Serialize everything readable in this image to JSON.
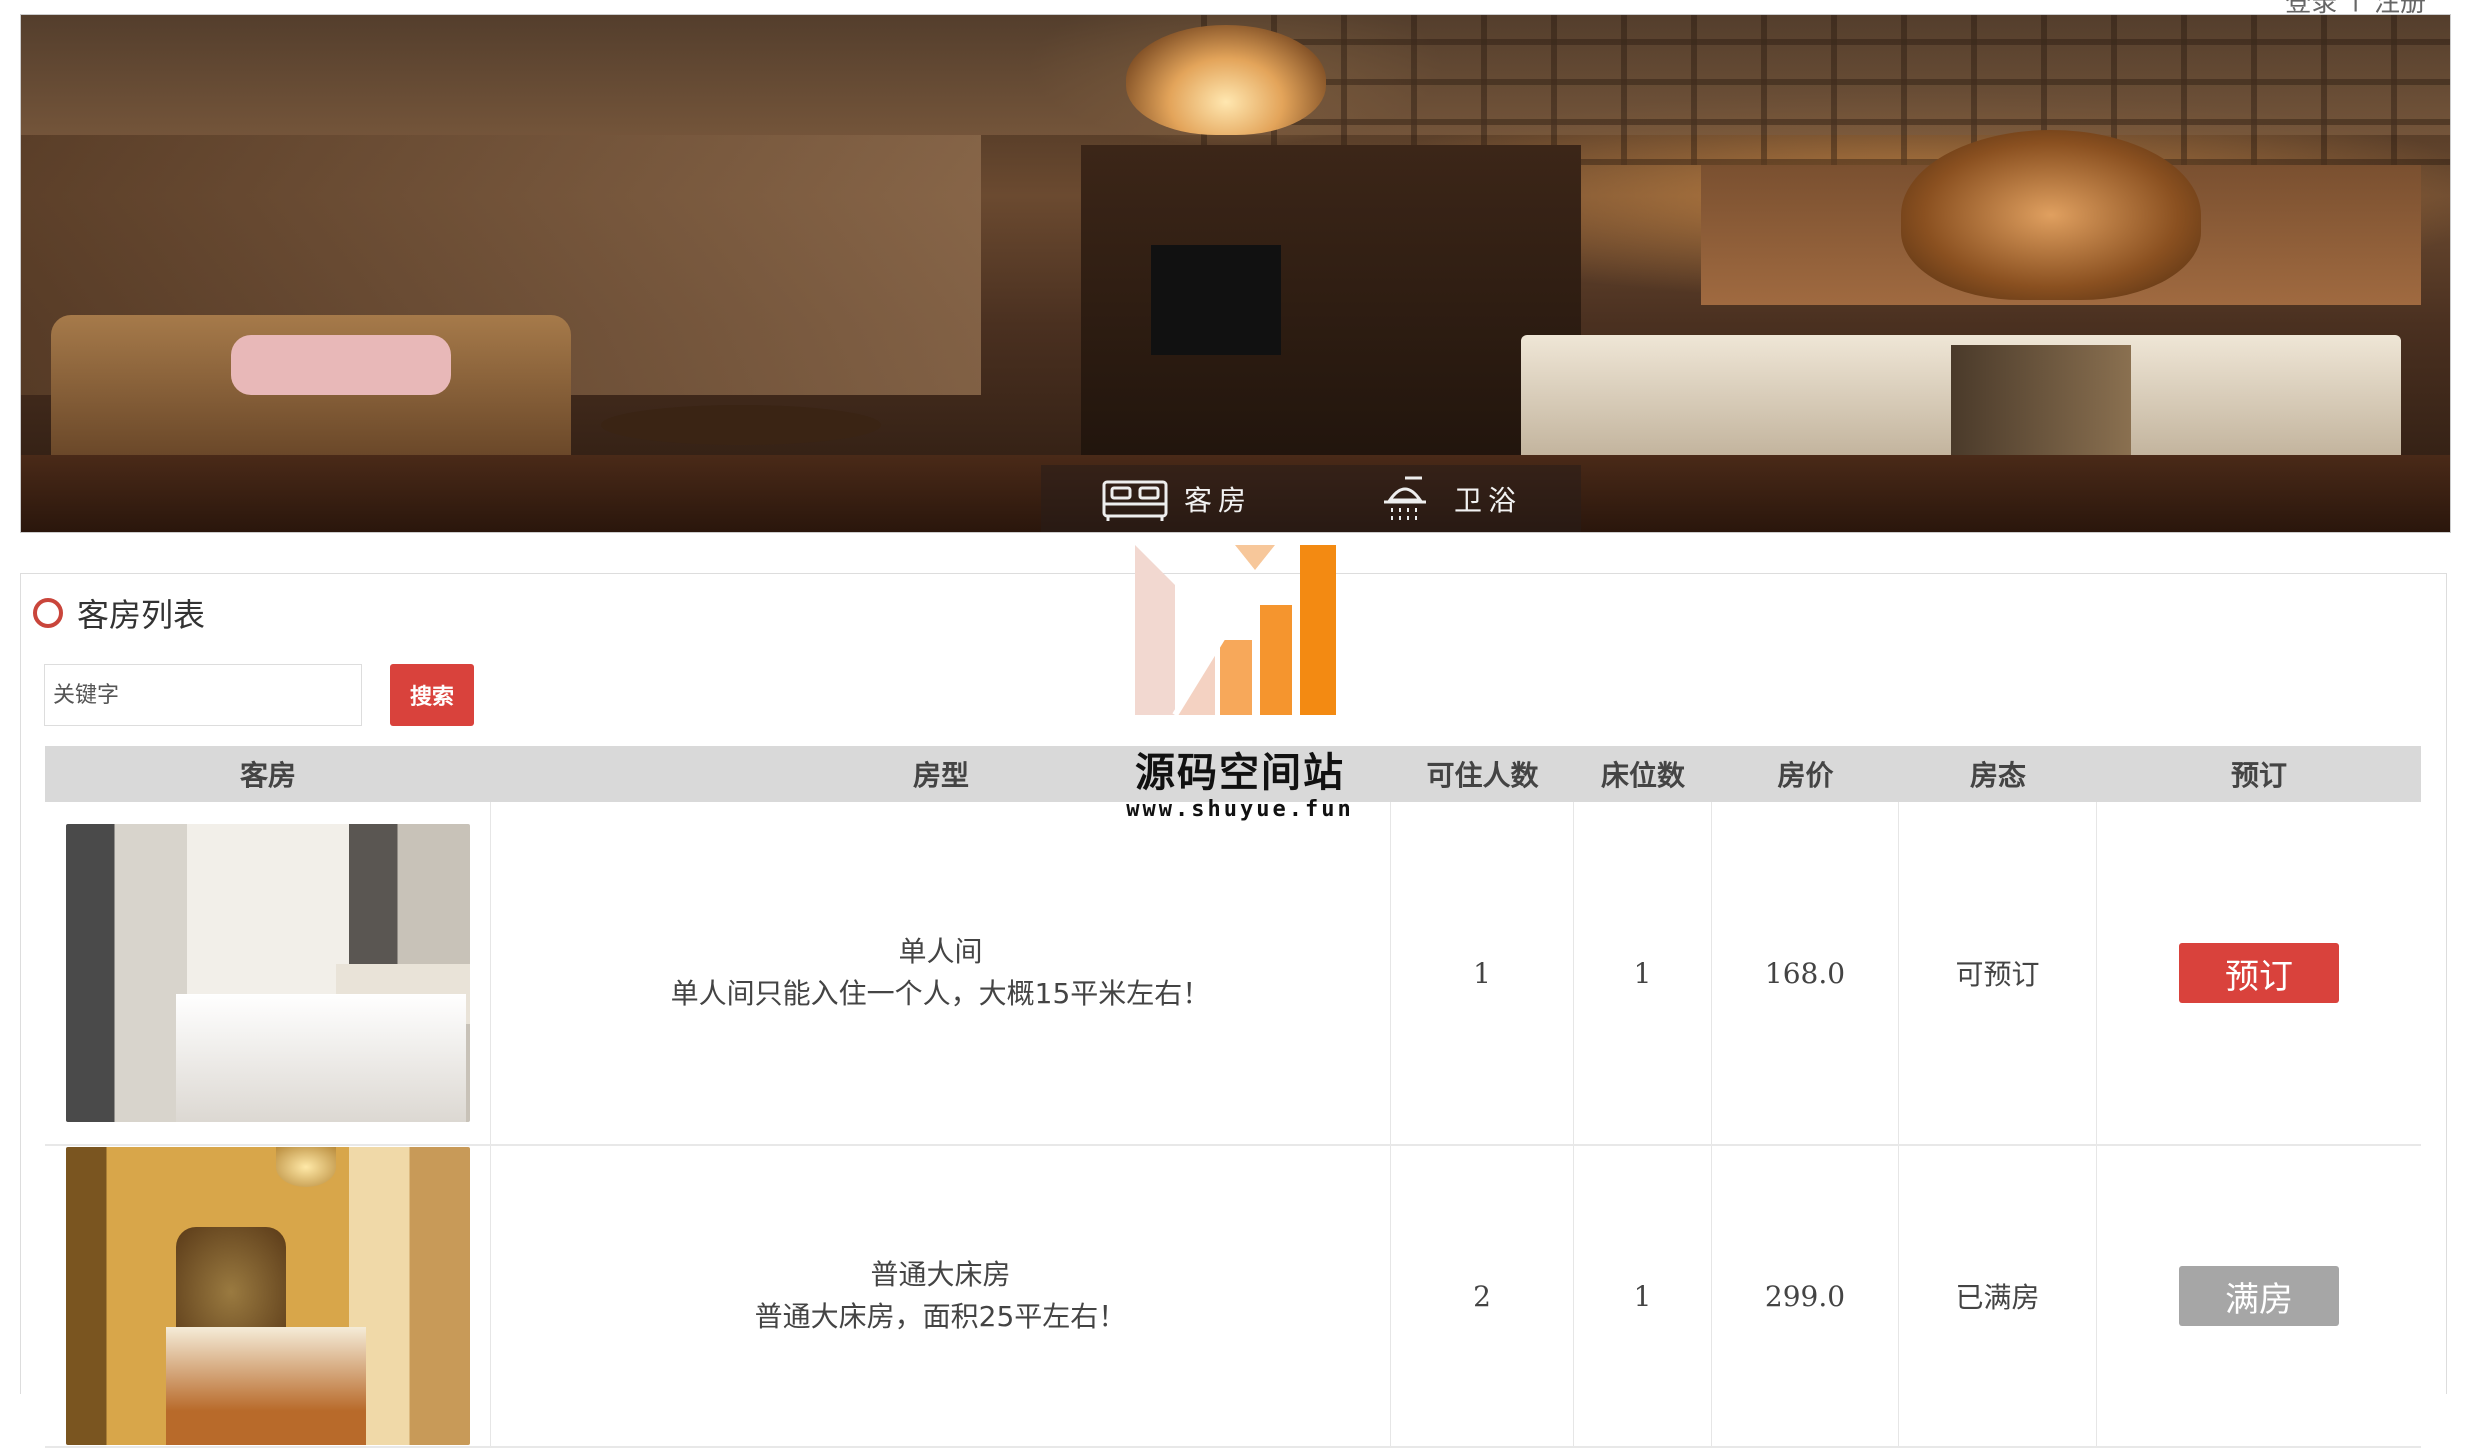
{
  "auth": {
    "login": "登录",
    "sep": "|",
    "register": "注册"
  },
  "banner": {
    "nav": [
      {
        "label": "客房",
        "icon": "bed-icon"
      },
      {
        "label": "卫浴",
        "icon": "shower-icon"
      }
    ]
  },
  "panel": {
    "title": "客房列表",
    "search": {
      "placeholder": "关键字",
      "button": "搜索"
    }
  },
  "table": {
    "headers": [
      "客房",
      "房型",
      "可住人数",
      "床位数",
      "房价",
      "房态",
      "预订"
    ],
    "rows": [
      {
        "type_name": "单人间",
        "type_desc": "单人间只能入住一个人，大概15平米左右！",
        "capacity": "1",
        "beds": "1",
        "price": "168.0",
        "status": "可预订",
        "action": "预订"
      },
      {
        "type_name": "普通大床房",
        "type_desc": "普通大床房，面积25平左右！",
        "capacity": "2",
        "beds": "1",
        "price": "299.0",
        "status": "已满房",
        "action": "满房"
      }
    ]
  },
  "watermark": {
    "title": "源码空间站",
    "url": "www.shuyue.fun"
  },
  "colors": {
    "accent": "#d9423c",
    "disabled": "#a6a6a6",
    "header_bg": "#d9d9d9"
  }
}
